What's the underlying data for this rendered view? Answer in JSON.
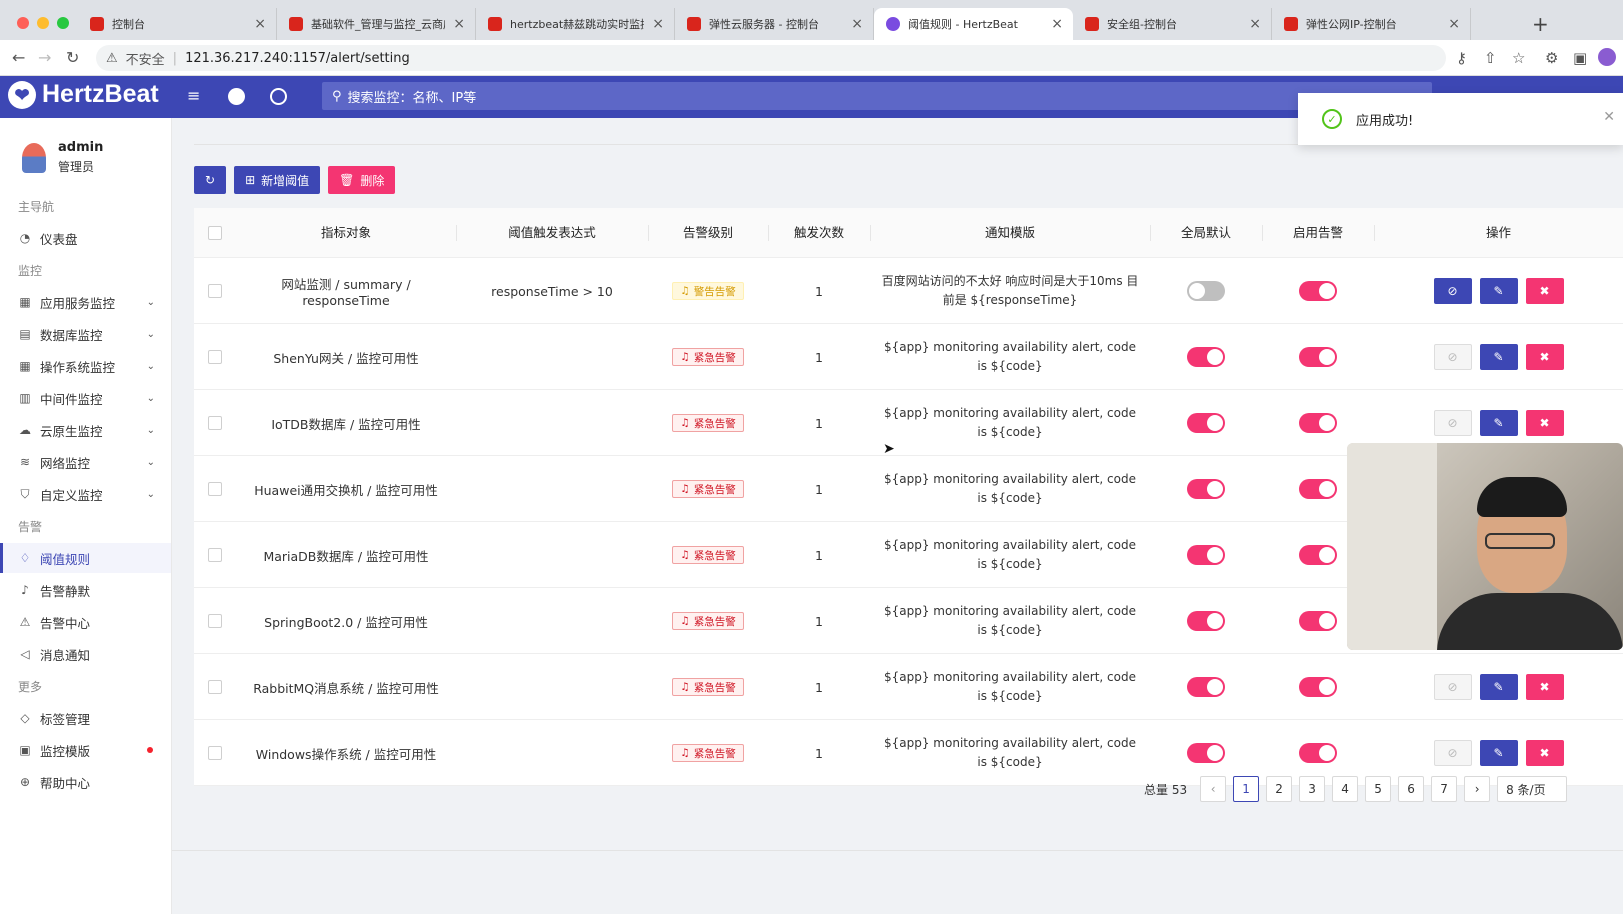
{
  "browser": {
    "tabs": [
      {
        "title": "控制台",
        "active": false
      },
      {
        "title": "基础软件_管理与监控_云商店-华",
        "active": false
      },
      {
        "title": "hertzbeat赫兹跳动实时监控_监",
        "active": false
      },
      {
        "title": "弹性云服务器 - 控制台",
        "active": false
      },
      {
        "title": "阈值规则 - HertzBeat",
        "active": true
      },
      {
        "title": "安全组-控制台",
        "active": false
      },
      {
        "title": "弹性公网IP-控制台",
        "active": false
      }
    ],
    "security_label": "不安全",
    "url": "121.36.217.240:1157/alert/setting"
  },
  "header": {
    "logo_text": "HertzBeat",
    "search_placeholder": "搜索监控：名称、IP等"
  },
  "user": {
    "name": "admin",
    "role": "管理员"
  },
  "sidebar": {
    "groups": [
      {
        "label": "主导航",
        "items": [
          {
            "label": "仪表盘",
            "icon": "dashboard-icon",
            "expandable": false
          }
        ]
      },
      {
        "label": "监控",
        "items": [
          {
            "label": "应用服务监控",
            "icon": "app-icon",
            "expandable": true
          },
          {
            "label": "数据库监控",
            "icon": "database-icon",
            "expandable": true
          },
          {
            "label": "操作系统监控",
            "icon": "os-icon",
            "expandable": true
          },
          {
            "label": "中间件监控",
            "icon": "middleware-icon",
            "expandable": true
          },
          {
            "label": "云原生监控",
            "icon": "cloud-icon",
            "expandable": true
          },
          {
            "label": "网络监控",
            "icon": "wifi-icon",
            "expandable": true
          },
          {
            "label": "自定义监控",
            "icon": "shirt-icon",
            "expandable": true
          }
        ]
      },
      {
        "label": "告警",
        "items": [
          {
            "label": "阈值规则",
            "icon": "bulb-icon",
            "active": true
          },
          {
            "label": "告警静默",
            "icon": "mute-icon"
          },
          {
            "label": "告警中心",
            "icon": "alarm-icon"
          },
          {
            "label": "消息通知",
            "icon": "notification-icon"
          }
        ]
      },
      {
        "label": "更多",
        "items": [
          {
            "label": "标签管理",
            "icon": "tag-icon"
          },
          {
            "label": "监控模版",
            "icon": "template-icon",
            "badge": true
          },
          {
            "label": "帮助中心",
            "icon": "globe-icon"
          }
        ]
      }
    ]
  },
  "toolbar": {
    "refresh_icon": "refresh-icon",
    "add_label": "新增阈值",
    "delete_label": "删除"
  },
  "table": {
    "columns": [
      "指标对象",
      "阈值触发表达式",
      "告警级别",
      "触发次数",
      "通知模版",
      "全局默认",
      "启用告警",
      "操作"
    ],
    "rows": [
      {
        "target": "网站监测 / summary / responseTime",
        "expr": "responseTime > 10",
        "level": "警告告警",
        "level_type": "warning",
        "times": "1",
        "template": "百度网站访问的不太好 响应时间是大于10ms 目前是 ${responseTime}",
        "global_default": false,
        "enabled": true,
        "link_enabled": true
      },
      {
        "target": "ShenYu网关 / 监控可用性",
        "expr": "",
        "level": "紧急告警",
        "level_type": "critical",
        "times": "1",
        "template": "${app} monitoring availability alert, code is ${code}",
        "global_default": true,
        "enabled": true,
        "link_enabled": false
      },
      {
        "target": "IoTDB数据库 / 监控可用性",
        "expr": "",
        "level": "紧急告警",
        "level_type": "critical",
        "times": "1",
        "template": "${app} monitoring availability alert, code is ${code}",
        "global_default": true,
        "enabled": true,
        "link_enabled": false
      },
      {
        "target": "Huawei通用交换机 / 监控可用性",
        "expr": "",
        "level": "紧急告警",
        "level_type": "critical",
        "times": "1",
        "template": "${app} monitoring availability alert, code is ${code}",
        "global_default": true,
        "enabled": true,
        "link_enabled": false
      },
      {
        "target": "MariaDB数据库 / 监控可用性",
        "expr": "",
        "level": "紧急告警",
        "level_type": "critical",
        "times": "1",
        "template": "${app} monitoring availability alert, code is ${code}",
        "global_default": true,
        "enabled": true,
        "link_enabled": false
      },
      {
        "target": "SpringBoot2.0 / 监控可用性",
        "expr": "",
        "level": "紧急告警",
        "level_type": "critical",
        "times": "1",
        "template": "${app} monitoring availability alert, code is ${code}",
        "global_default": true,
        "enabled": true,
        "link_enabled": false
      },
      {
        "target": "RabbitMQ消息系统 / 监控可用性",
        "expr": "",
        "level": "紧急告警",
        "level_type": "critical",
        "times": "1",
        "template": "${app} monitoring availability alert, code is ${code}",
        "global_default": true,
        "enabled": true,
        "link_enabled": false
      },
      {
        "target": "Windows操作系统 / 监控可用性",
        "expr": "",
        "level": "紧急告警",
        "level_type": "critical",
        "times": "1",
        "template": "${app} monitoring availability alert, code is ${code}",
        "global_default": true,
        "enabled": true,
        "link_enabled": false
      }
    ]
  },
  "pagination": {
    "total_label": "总量 53",
    "pages": [
      "1",
      "2",
      "3",
      "4",
      "5",
      "6",
      "7"
    ],
    "current": "1",
    "page_size_label": "8 条/页"
  },
  "toast": {
    "message": "应用成功!"
  },
  "colors": {
    "brand": "#3d47b4",
    "danger": "#f43572",
    "success": "#52c41a"
  }
}
